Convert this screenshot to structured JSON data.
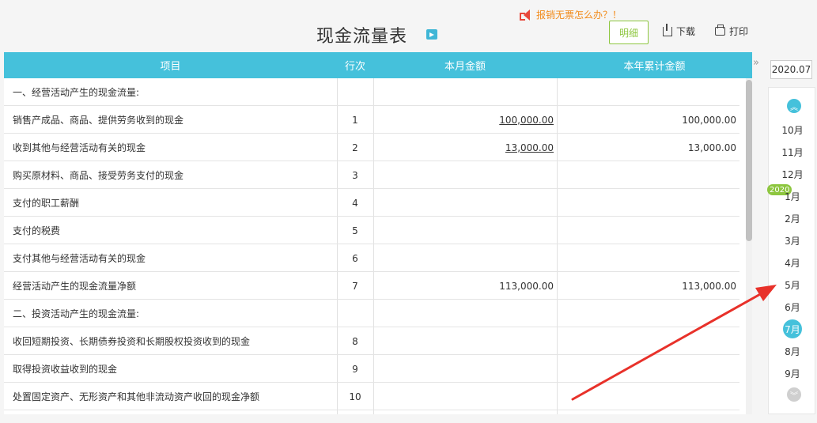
{
  "header": {
    "title": "现金流量表",
    "notice": "报销无票怎么办？！",
    "detail_button": "明细",
    "download_button": "下载",
    "print_button": "打印"
  },
  "table": {
    "columns": [
      "项目",
      "行次",
      "本月金额",
      "本年累计金额"
    ],
    "rows": [
      {
        "item": "一、经营活动产生的现金流量:",
        "line": "",
        "month": "",
        "year": ""
      },
      {
        "item": "销售产成品、商品、提供劳务收到的现金",
        "line": "1",
        "month": "100,000.00",
        "year": "100,000.00"
      },
      {
        "item": "收到其他与经营活动有关的现金",
        "line": "2",
        "month": "13,000.00",
        "year": "13,000.00"
      },
      {
        "item": "购买原材料、商品、接受劳务支付的现金",
        "line": "3",
        "month": "",
        "year": ""
      },
      {
        "item": "支付的职工薪酬",
        "line": "4",
        "month": "",
        "year": ""
      },
      {
        "item": "支付的税费",
        "line": "5",
        "month": "",
        "year": ""
      },
      {
        "item": "支付其他与经营活动有关的现金",
        "line": "6",
        "month": "",
        "year": ""
      },
      {
        "item": "经营活动产生的现金流量净额",
        "line": "7",
        "month": "113,000.00",
        "year": "113,000.00"
      },
      {
        "item": "二、投资活动产生的现金流量:",
        "line": "",
        "month": "",
        "year": ""
      },
      {
        "item": "收回短期投资、长期债券投资和长期股权投资收到的现金",
        "line": "8",
        "month": "",
        "year": ""
      },
      {
        "item": "取得投资收益收到的现金",
        "line": "9",
        "month": "",
        "year": ""
      },
      {
        "item": "处置固定资产、无形资产和其他非流动资产收回的现金净额",
        "line": "10",
        "month": "",
        "year": ""
      }
    ]
  },
  "period": {
    "collapse": "»",
    "selected": "2020.07",
    "year_badge": "2020",
    "months": [
      "10月",
      "11月",
      "12月",
      "1月",
      "2月",
      "3月",
      "4月",
      "5月",
      "6月",
      "7月",
      "8月",
      "9月"
    ],
    "active_index": 9
  },
  "colors": {
    "accent": "#45c1db",
    "green": "#8dc63f",
    "notice": "#f28b1a",
    "arrow": "#e8312a"
  }
}
